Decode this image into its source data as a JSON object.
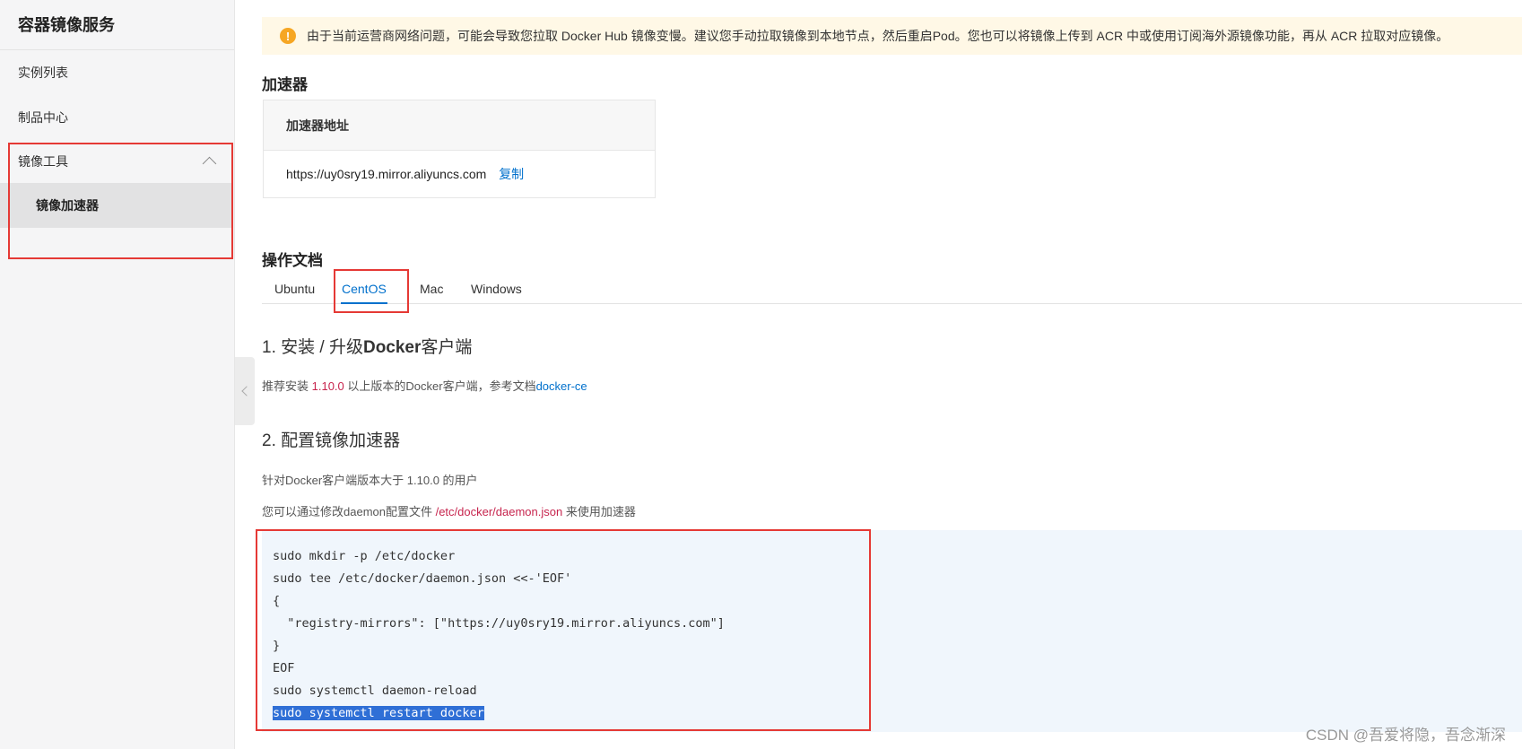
{
  "sidebar": {
    "title": "容器镜像服务",
    "items": [
      {
        "label": "实例列表"
      },
      {
        "label": "制品中心"
      }
    ],
    "group": {
      "label": "镜像工具",
      "sub_item": "镜像加速器"
    }
  },
  "notice": {
    "text": "由于当前运营商网络问题，可能会导致您拉取 Docker Hub 镜像变慢。建议您手动拉取镜像到本地节点，然后重启Pod。您也可以将镜像上传到 ACR 中或使用订阅海外源镜像功能，再从 ACR 拉取对应镜像。"
  },
  "accelerator": {
    "heading": "加速器",
    "column_header": "加速器地址",
    "address": "https://uy0sry19.mirror.aliyuncs.com",
    "copy_label": "复制"
  },
  "docs": {
    "heading": "操作文档",
    "tabs": [
      "Ubuntu",
      "CentOS",
      "Mac",
      "Windows"
    ],
    "active_tab": "CentOS",
    "step1": {
      "prefix": "1. 安装 / 升级",
      "bold": "Docker",
      "suffix": "客户端"
    },
    "p1": {
      "before": "推荐安装 ",
      "version": "1.10.0",
      "middle": " 以上版本的Docker客户端，参考文档",
      "link": "docker-ce"
    },
    "step2": "2. 配置镜像加速器",
    "p2": "针对Docker客户端版本大于 1.10.0 的用户",
    "p3": {
      "before": "您可以通过修改daemon配置文件 ",
      "path": "/etc/docker/daemon.json",
      "after": " 来使用加速器"
    },
    "code": [
      "sudo mkdir -p /etc/docker",
      "sudo tee /etc/docker/daemon.json <<-'EOF'",
      "{",
      "  \"registry-mirrors\": [\"https://uy0sry19.mirror.aliyuncs.com\"]",
      "}",
      "EOF",
      "sudo systemctl daemon-reload",
      "sudo systemctl restart docker"
    ]
  },
  "watermark": "CSDN @吾爱将隐，吾念渐深",
  "colors": {
    "accent": "#0070cc",
    "highlight_box": "#e53935",
    "notice_bg": "#fff8e6",
    "warning": "#f6a623",
    "code_bg": "#f0f6fc",
    "selection": "#2f6fd6"
  }
}
